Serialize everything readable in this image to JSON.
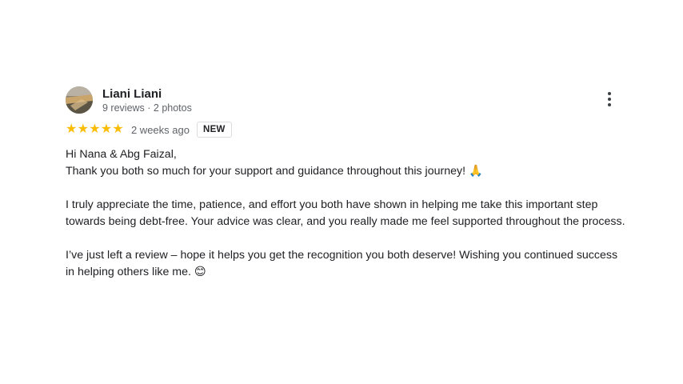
{
  "review": {
    "author_name": "Liani Liani",
    "author_meta": "9 reviews · 2 photos",
    "rating": 5,
    "stars": [
      "★",
      "★",
      "★",
      "★",
      "★"
    ],
    "time_ago": "2 weeks ago",
    "badge": "NEW",
    "more_icon": "more-vert-icon",
    "colors": {
      "star": "#fbbc04",
      "text": "#202124",
      "muted": "#5f6368"
    },
    "body": {
      "line1": "Hi Nana & Abg Faizal,",
      "line2": "Thank you both so much for your support and guidance throughout this journey!",
      "line2_emoji": "🙏",
      "para2": "I truly appreciate the time, patience, and effort you both have shown in helping me take this important step towards being debt-free. Your advice was clear, and you really made me feel supported throughout the process.",
      "para3": "I’ve just left a review – hope it helps you get the recognition you both deserve! Wishing you continued success in helping others like me.",
      "para3_emoji": "😊"
    }
  }
}
